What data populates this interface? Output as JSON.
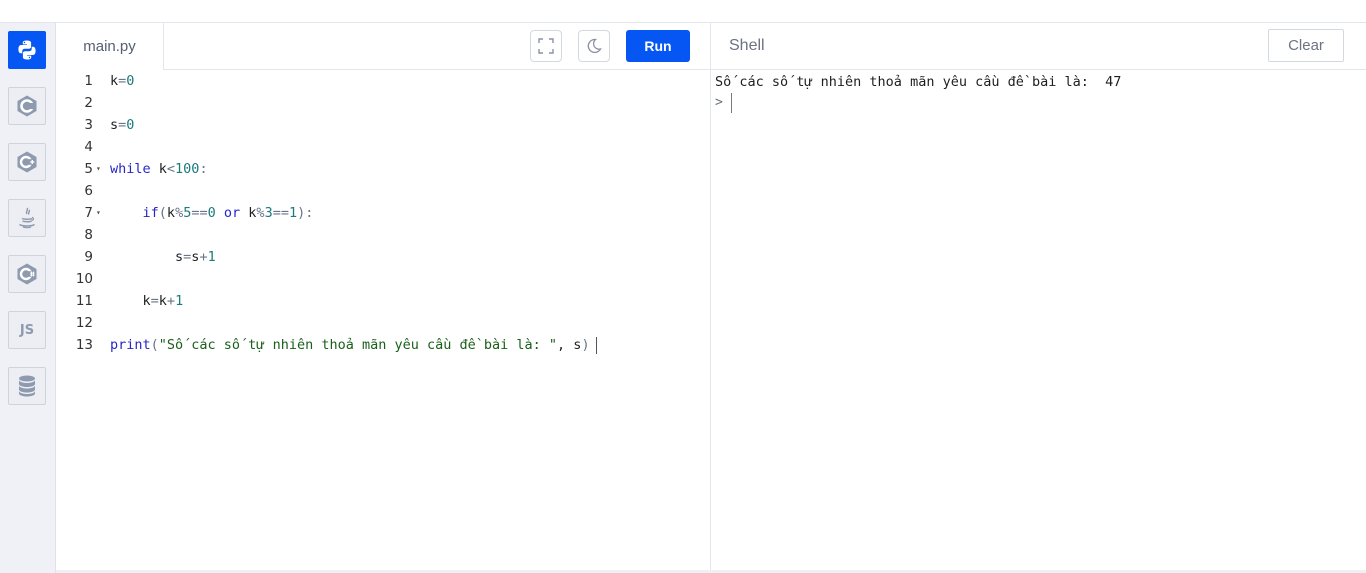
{
  "sidebar": {
    "items": [
      {
        "name": "python-icon",
        "label": "Python",
        "active": true
      },
      {
        "name": "c-icon",
        "label": "C"
      },
      {
        "name": "cpp-icon",
        "label": "C++"
      },
      {
        "name": "java-icon",
        "label": "Java"
      },
      {
        "name": "csharp-icon",
        "label": "C#"
      },
      {
        "name": "js-icon",
        "label": "JS"
      },
      {
        "name": "database-icon",
        "label": "SQL"
      }
    ]
  },
  "editor": {
    "tab_label": "main.py",
    "run_label": "Run",
    "lines": [
      {
        "n": "1",
        "text": "k=0"
      },
      {
        "n": "2",
        "text": ""
      },
      {
        "n": "3",
        "text": "s=0"
      },
      {
        "n": "4",
        "text": ""
      },
      {
        "n": "5",
        "text": "while k<100:"
      },
      {
        "n": "6",
        "text": ""
      },
      {
        "n": "7",
        "text": "    if(k%5==0 or k%3==1):"
      },
      {
        "n": "8",
        "text": ""
      },
      {
        "n": "9",
        "text": "        s=s+1"
      },
      {
        "n": "10",
        "text": ""
      },
      {
        "n": "11",
        "text": "    k=k+1"
      },
      {
        "n": "12",
        "text": ""
      },
      {
        "n": "13",
        "text": "print(\"Số các số tự nhiên thoả mãn yêu cầu đề bài là: \", s)"
      }
    ]
  },
  "shell": {
    "title": "Shell",
    "clear_label": "Clear",
    "output": "Số các số tự nhiên thoả mãn yêu cầu đề bài là:  47",
    "prompt": ">"
  },
  "colors": {
    "accent": "#0556f3",
    "keyword": "#2626c8",
    "number": "#1b7a7a",
    "string": "#1a5f1a"
  }
}
